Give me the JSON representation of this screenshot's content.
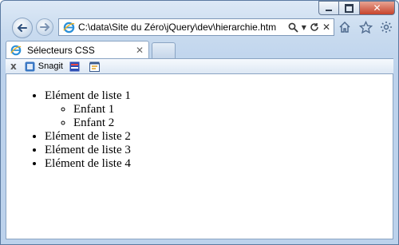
{
  "window": {
    "caption_buttons": {
      "minimize": "minimize",
      "maximize": "maximize",
      "close": "✕"
    }
  },
  "nav": {
    "back_icon": "back-arrow-icon",
    "forward_icon": "forward-arrow-icon",
    "address": "C:\\data\\Site du Zéro\\jQuery\\dev\\hierarchie.htm",
    "search_icon": "search-icon",
    "refresh_icon": "refresh-icon",
    "stop_label": "✕",
    "right_icons": [
      "home-icon",
      "favorites-star-icon",
      "settings-gear-icon"
    ]
  },
  "tabs": [
    {
      "title": "Sélecteurs CSS",
      "close_label": "✕"
    }
  ],
  "command_bar": {
    "close_label": "x",
    "items": [
      {
        "label": "Snagit",
        "icon": "snagit-icon"
      },
      {
        "label": "",
        "icon": "snagit-editor-icon"
      },
      {
        "label": "",
        "icon": "snagit-capture-icon"
      }
    ]
  },
  "content": {
    "list": [
      {
        "text": "Elément de liste 1",
        "children": [
          "Enfant 1",
          "Enfant 2"
        ]
      },
      {
        "text": "Elément de liste 2"
      },
      {
        "text": "Elément de liste 3"
      },
      {
        "text": "Elément de liste 4"
      }
    ]
  },
  "colors": {
    "frame": "#c9dbef",
    "close_button": "#c7432b",
    "page_background": "#ffffff"
  }
}
